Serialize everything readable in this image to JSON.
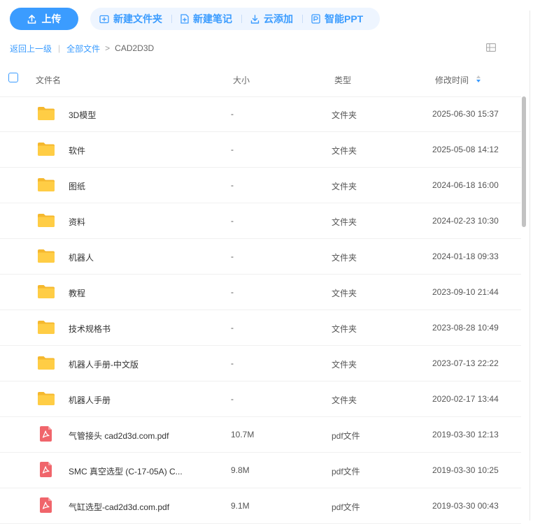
{
  "toolbar": {
    "upload_label": "上传",
    "actions": [
      {
        "label": "新建文件夹",
        "icon": "folder-plus-icon"
      },
      {
        "label": "新建笔记",
        "icon": "note-plus-icon"
      },
      {
        "label": "云添加",
        "icon": "download-icon"
      },
      {
        "label": "智能PPT",
        "icon": "ppt-icon"
      }
    ]
  },
  "breadcrumb": {
    "back": "返回上一级",
    "all_files": "全部文件",
    "current": "CAD2D3D"
  },
  "columns": {
    "name": "文件名",
    "size": "大小",
    "type": "类型",
    "modified": "修改时间"
  },
  "files": [
    {
      "name": "3D模型",
      "size": "-",
      "type": "文件夹",
      "time": "2025-06-30 15:37",
      "kind": "folder"
    },
    {
      "name": "软件",
      "size": "-",
      "type": "文件夹",
      "time": "2025-05-08 14:12",
      "kind": "folder"
    },
    {
      "name": "图纸",
      "size": "-",
      "type": "文件夹",
      "time": "2024-06-18 16:00",
      "kind": "folder"
    },
    {
      "name": "资料",
      "size": "-",
      "type": "文件夹",
      "time": "2024-02-23 10:30",
      "kind": "folder"
    },
    {
      "name": "机器人",
      "size": "-",
      "type": "文件夹",
      "time": "2024-01-18 09:33",
      "kind": "folder"
    },
    {
      "name": "教程",
      "size": "-",
      "type": "文件夹",
      "time": "2023-09-10 21:44",
      "kind": "folder"
    },
    {
      "name": "技术规格书",
      "size": "-",
      "type": "文件夹",
      "time": "2023-08-28 10:49",
      "kind": "folder"
    },
    {
      "name": "机器人手册-中文版",
      "size": "-",
      "type": "文件夹",
      "time": "2023-07-13 22:22",
      "kind": "folder"
    },
    {
      "name": "机器人手册",
      "size": "-",
      "type": "文件夹",
      "time": "2020-02-17 13:44",
      "kind": "folder"
    },
    {
      "name": "气管接头 cad2d3d.com.pdf",
      "size": "10.7M",
      "type": "pdf文件",
      "time": "2019-03-30 12:13",
      "kind": "pdf"
    },
    {
      "name": "SMC 真空选型 (C-17-05A) C...",
      "size": "9.8M",
      "type": "pdf文件",
      "time": "2019-03-30 10:25",
      "kind": "pdf"
    },
    {
      "name": "气缸选型-cad2d3d.com.pdf",
      "size": "9.1M",
      "type": "pdf文件",
      "time": "2019-03-30 00:43",
      "kind": "pdf"
    }
  ],
  "colors": {
    "accent": "#3b9cff",
    "folder": "#ffc93e",
    "pdf": "#f0656b"
  }
}
